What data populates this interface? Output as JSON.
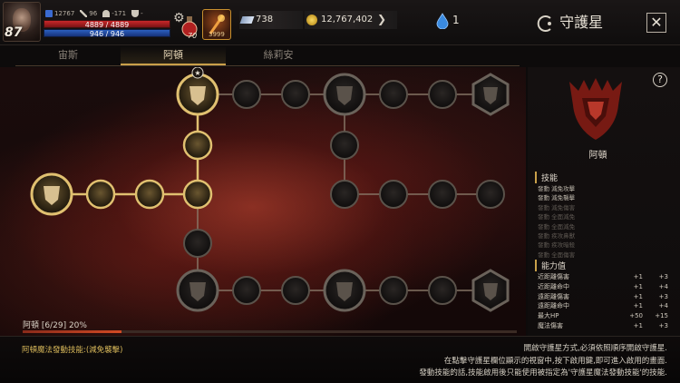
{
  "player": {
    "level": "87",
    "stat1": "12767",
    "stat2": "96",
    "stat3": "-171",
    "stat4": "-",
    "hp": "4889 / 4889",
    "mp": "946 / 946",
    "potion_count": "70",
    "skill_count": "3999"
  },
  "currency": {
    "crystal": "738",
    "gold": "12,767,402",
    "gem": "1"
  },
  "header": {
    "title": "守護星",
    "close": "✕"
  },
  "tabs": [
    {
      "label": "宙斯",
      "active": false
    },
    {
      "label": "阿頓",
      "active": true
    },
    {
      "label": "絲莉安",
      "active": false
    }
  ],
  "constellation": {
    "name": "阿頓",
    "progress_text": "阿頓 [6/29] 20%",
    "progress_fraction": 0.2
  },
  "panel": {
    "help": "?",
    "skills_title": "技能",
    "skills": [
      {
        "text": "發動 減免攻擊",
        "active": true
      },
      {
        "text": "發動 減免襲擊",
        "active": true
      },
      {
        "text": "發動 減免傷害",
        "active": false
      },
      {
        "text": "發動 全面減免",
        "active": false
      },
      {
        "text": "發動 全面減免",
        "active": false
      },
      {
        "text": "發動 疾攻鼻獸",
        "active": false
      },
      {
        "text": "發動 疾攻暗殺",
        "active": false
      },
      {
        "text": "發動 全面傷害",
        "active": false
      }
    ],
    "abilities_title": "能力值",
    "abilities": [
      {
        "name": "近距離傷害",
        "v1": "+1",
        "v2": "+3"
      },
      {
        "name": "近距離命中",
        "v1": "+1",
        "v2": "+4"
      },
      {
        "name": "遠距離傷害",
        "v1": "+1",
        "v2": "+3"
      },
      {
        "name": "遠距離命中",
        "v1": "+1",
        "v2": "+4"
      },
      {
        "name": "最大HP",
        "v1": "+50",
        "v2": "+15"
      },
      {
        "name": "魔法傷害",
        "v1": "+1",
        "v2": "+3"
      }
    ]
  },
  "bottom": {
    "magic_skill": "阿頓魔法發動技能:(減免襲擊)",
    "instructions": [
      "開啟守護星方式,必須依照順序開啟守護星.",
      "在點擊守護星欄位顯示的視窗中,按下啟用鍵,即可進入啟用的畫面.",
      "發動技能的話,技能啟用後只能使用被指定為'守護星魔法發動技能'的技能."
    ]
  },
  "colors": {
    "accent": "#c9a04a",
    "hp": "#c8282a",
    "mp": "#2b5fbf",
    "node_active": "#e0c070"
  }
}
